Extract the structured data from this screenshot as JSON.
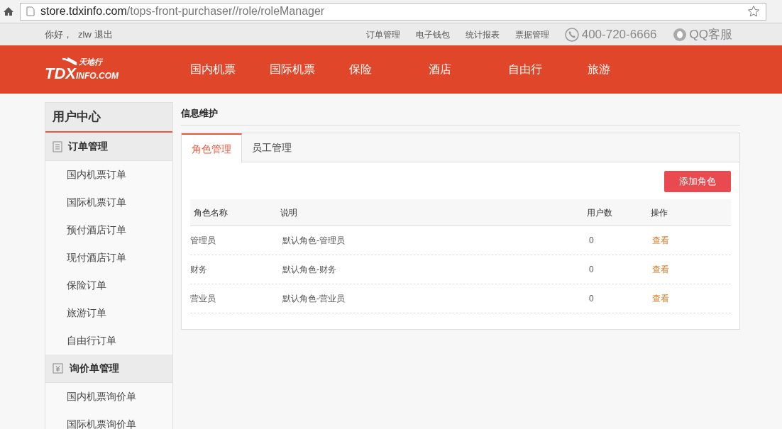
{
  "browser": {
    "url_host": "store.tdxinfo.com",
    "url_path": "/tops-front-purchaser//role/roleManager"
  },
  "top_bar": {
    "greeting": "你好，",
    "user": "zlw",
    "logout": "退出",
    "links": [
      "订单管理",
      "电子钱包",
      "统计报表",
      "票据管理"
    ],
    "phone": "400-720-6666",
    "qq": "QQ客服"
  },
  "header": {
    "logo_main": "TDX",
    "logo_sub": "INFO.COM",
    "logo_cn": "天地行",
    "nav": [
      "国内机票",
      "国际机票",
      "保险",
      "酒店",
      "自由行",
      "旅游"
    ]
  },
  "sidebar": {
    "title": "用户中心",
    "groups": [
      {
        "kind": "list",
        "label": "订单管理",
        "items": [
          "国内机票订单",
          "国际机票订单",
          "预付酒店订单",
          "现付酒店订单",
          "保险订单",
          "旅游订单",
          "自由行订单"
        ]
      },
      {
        "kind": "price",
        "label": "询价单管理",
        "items": [
          "国内机票询价单",
          "国际机票询价单"
        ]
      }
    ]
  },
  "content": {
    "title": "信息维护",
    "tabs": [
      {
        "label": "角色管理",
        "selected": true
      },
      {
        "label": "员工管理",
        "selected": false
      }
    ],
    "add_button": "添加角色",
    "table": {
      "columns": [
        "角色名称",
        "说明",
        "用户数",
        "操作"
      ],
      "rows": [
        {
          "name": "管理员",
          "description": "默认角色-管理员",
          "users": "0",
          "action": "查看"
        },
        {
          "name": "财务",
          "description": "默认角色-财务",
          "users": "0",
          "action": "查看"
        },
        {
          "name": "营业员",
          "description": "默认角色-营业员",
          "users": "0",
          "action": "查看"
        }
      ]
    }
  }
}
